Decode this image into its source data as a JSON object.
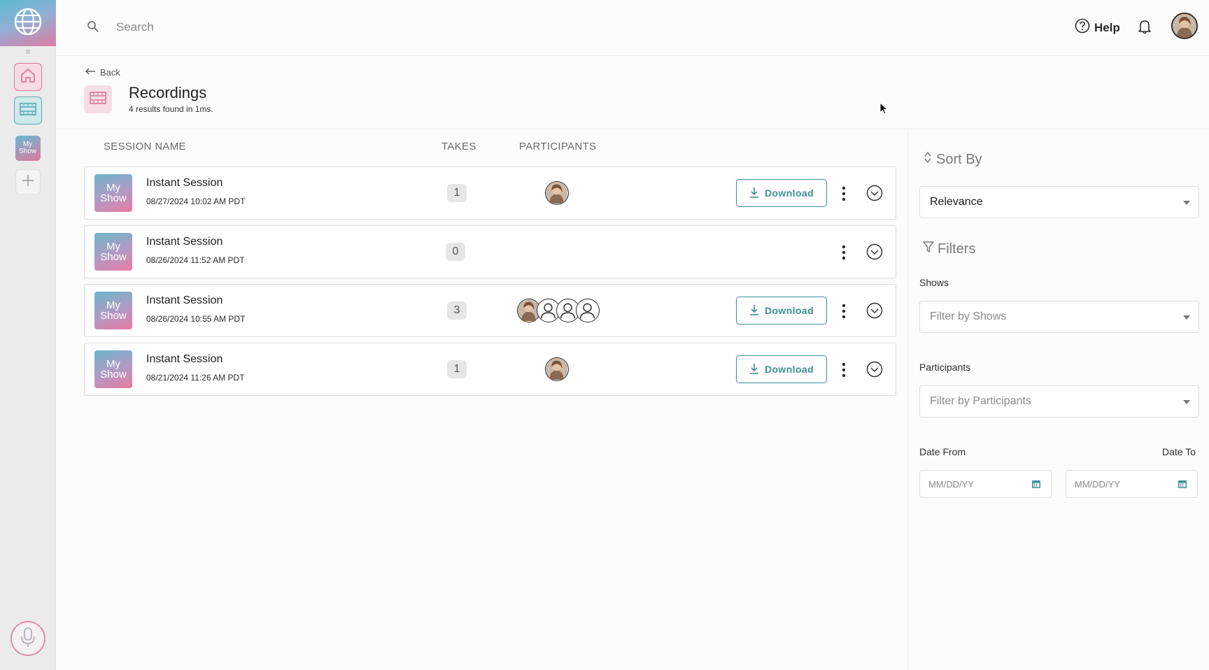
{
  "colors": {
    "accent_teal": "#3d8f98",
    "accent_pink": "#d87b9c",
    "gradient_from": "#6ab6cc",
    "gradient_to": "#e87ba2"
  },
  "rail": {
    "logo_icon": "globe-icon",
    "grip_icon": "drag-handle-icon",
    "items": [
      {
        "name": "home",
        "icon": "home-icon"
      },
      {
        "name": "recordings",
        "icon": "film-strip-icon"
      }
    ],
    "show_thumb": [
      "My",
      "Show"
    ],
    "add_icon": "plus-icon",
    "mic_icon": "microphone-icon"
  },
  "topbar": {
    "search_placeholder": "Search",
    "help_label": "Help",
    "help_icon": "question-circle-icon",
    "bell_icon": "bell-icon"
  },
  "page": {
    "back_label": "Back",
    "title": "Recordings",
    "subtitle": "4 results found in 1ms."
  },
  "table": {
    "headers": {
      "session_name": "SESSION NAME",
      "takes": "TAKES",
      "participants": "PARTICIPANTS"
    },
    "rows": [
      {
        "thumb_line1": "My",
        "thumb_line2": "Show",
        "name": "Instant Session",
        "date": "08/27/2024 10:02 AM PDT",
        "takes": "1",
        "participants": [
          "photo"
        ],
        "download_label": "Download",
        "has_download": true
      },
      {
        "thumb_line1": "My",
        "thumb_line2": "Show",
        "name": "Instant Session",
        "date": "08/26/2024 11:52 AM PDT",
        "takes": "0",
        "participants": [],
        "download_label": "",
        "has_download": false
      },
      {
        "thumb_line1": "My",
        "thumb_line2": "Show",
        "name": "Instant Session",
        "date": "08/26/2024 10:55 AM PDT",
        "takes": "3",
        "participants": [
          "photo",
          "placeholder",
          "placeholder",
          "placeholder"
        ],
        "download_label": "Download",
        "has_download": true
      },
      {
        "thumb_line1": "My",
        "thumb_line2": "Show",
        "name": "Instant Session",
        "date": "08/21/2024 11:26 AM PDT",
        "takes": "1",
        "participants": [
          "photo"
        ],
        "download_label": "Download",
        "has_download": true
      }
    ]
  },
  "sidebar": {
    "sort_title": "Sort By",
    "sort_value": "Relevance",
    "filters_title": "Filters",
    "shows_label": "Shows",
    "shows_placeholder": "Filter by Shows",
    "participants_label": "Participants",
    "participants_placeholder": "Filter by Participants",
    "date_from_label": "Date From",
    "date_to_label": "Date To",
    "date_from_placeholder": "MM/DD/YY",
    "date_to_placeholder": "MM/DD/YY"
  }
}
